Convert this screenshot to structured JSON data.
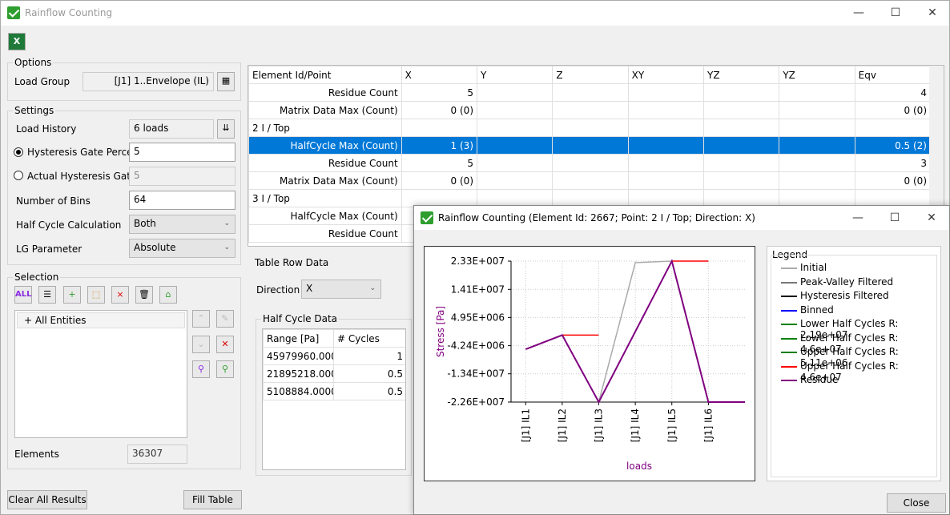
{
  "window": {
    "title": "Rainflow Counting",
    "minimize": "—",
    "maximize": "☐",
    "close": "✕"
  },
  "toolbar": {
    "excel_icon": "excel-export-icon"
  },
  "options": {
    "group_label": "Options",
    "load_group_label": "Load Group",
    "load_group_value": "[J1] 1..Envelope (IL)"
  },
  "settings": {
    "group_label": "Settings",
    "load_history_label": "Load History",
    "load_history_value": "6 loads",
    "hyst_percent_label": "Hysteresis Gate Percent",
    "hyst_percent_value": "5",
    "actual_hyst_label": "Actual Hysteresis Gate",
    "actual_hyst_value": "5",
    "bins_label": "Number of Bins",
    "bins_value": "64",
    "half_cycle_label": "Half Cycle Calculation",
    "half_cycle_value": "Both",
    "lg_param_label": "LG Parameter",
    "lg_param_value": "Absolute"
  },
  "selection": {
    "group_label": "Selection",
    "tree_item": "+ All Entities",
    "elements_label": "Elements",
    "elements_value": "36307"
  },
  "buttons": {
    "clear_all": "Clear All Results",
    "fill_table": "Fill Table",
    "close": "Close"
  },
  "grid": {
    "headers": [
      "Element Id/Point",
      "X",
      "Y",
      "Z",
      "XY",
      "YZ",
      "YZ",
      "Eqv"
    ],
    "rows": [
      [
        "Residue Count",
        "5",
        "",
        "",
        "",
        "",
        "",
        "4"
      ],
      [
        "Matrix Data Max (Count)",
        "0 (0)",
        "",
        "",
        "",
        "",
        "",
        "0 (0)"
      ],
      [
        "2 I / Top",
        "",
        "",
        "",
        "",
        "",
        "",
        ""
      ],
      [
        "HalfCycle Max (Count)",
        "1 (3)",
        "",
        "",
        "",
        "",
        "",
        "0.5 (2)"
      ],
      [
        "Residue Count",
        "5",
        "",
        "",
        "",
        "",
        "",
        "3"
      ],
      [
        "Matrix Data Max (Count)",
        "0 (0)",
        "",
        "",
        "",
        "",
        "",
        "0 (0)"
      ],
      [
        "3 I / Top",
        "",
        "",
        "",
        "",
        "",
        "",
        ""
      ],
      [
        "HalfCycle Max (Count)",
        "",
        "",
        "",
        "",
        "",
        "",
        ""
      ],
      [
        "Residue Count",
        "",
        "",
        "",
        "",
        "",
        "",
        ""
      ]
    ]
  },
  "table_row_data": {
    "label": "Table Row Data",
    "direction_label": "Direction",
    "direction_value": "X",
    "half_cycle_label": "Half Cycle Data",
    "hc_headers": [
      "Range  [Pa]",
      "# Cycles"
    ],
    "hc_rows": [
      [
        "45979960.00000",
        "1"
      ],
      [
        "21895218.00000",
        "0.5"
      ],
      [
        "5108884.000000",
        "0.5"
      ]
    ]
  },
  "popup": {
    "title": "Rainflow Counting (Element Id: 2667; Point: 2 I / Top; Direction: X)",
    "minimize": "—",
    "maximize": "☐",
    "close": "✕",
    "legend_title": "Legend",
    "legend": [
      {
        "name": "Initial",
        "color": "#aaaaaa"
      },
      {
        "name": "Peak-Valley Filtered",
        "color": "#777777"
      },
      {
        "name": "Hysteresis Filtered",
        "color": "#000000"
      },
      {
        "name": "Binned",
        "color": "#0000ff"
      },
      {
        "name": "Lower Half Cycles R: 2.19e+07",
        "color": "#008000"
      },
      {
        "name": "Lower Half Cycles R: 4.6e+07",
        "color": "#008000"
      },
      {
        "name": "Upper Half Cycles R: 5.11e+06",
        "color": "#008000"
      },
      {
        "name": "Upper Half Cycles R: 4.6e+07",
        "color": "#ff0000"
      },
      {
        "name": "Residue",
        "color": "#800080"
      }
    ]
  },
  "chart_data": {
    "type": "line",
    "xlabel": "loads",
    "ylabel": "Stress [Pa]",
    "categories": [
      "[J1] IL1",
      "[J1] IL2",
      "[J1] IL3",
      "[J1] IL4",
      "[J1] IL5",
      "[J1] IL6"
    ],
    "ytick_labels": [
      "2.33E+007",
      "1.41E+007",
      "4.95E+006",
      "-4.24E+006",
      "-1.34E+007",
      "-2.26E+007"
    ],
    "ytick_values": [
      23300000,
      14100000,
      4950000,
      -4240000,
      -13400000,
      -22600000
    ],
    "ylim": [
      -22600000,
      23300000
    ],
    "series": [
      {
        "name": "Initial",
        "color": "#aaaaaa",
        "x": [
          0,
          1,
          2,
          3,
          4,
          5
        ],
        "values": [
          -5400000,
          -800000,
          -22600000,
          22800000,
          23300000,
          -22600000
        ]
      },
      {
        "name": "Upper Half Cycles R: 4.6e+07",
        "color": "#ff0000",
        "x": [
          1,
          2,
          4,
          5
        ],
        "values": [
          -800000,
          -800000,
          23300000,
          23300000
        ],
        "segments": [
          [
            0,
            1
          ],
          [
            2,
            3
          ]
        ]
      },
      {
        "name": "Residue",
        "color": "#800080",
        "x": [
          0,
          1,
          2,
          4,
          5,
          6
        ],
        "values": [
          -5400000,
          -800000,
          -22600000,
          23300000,
          -22600000,
          -22600000
        ]
      }
    ]
  }
}
